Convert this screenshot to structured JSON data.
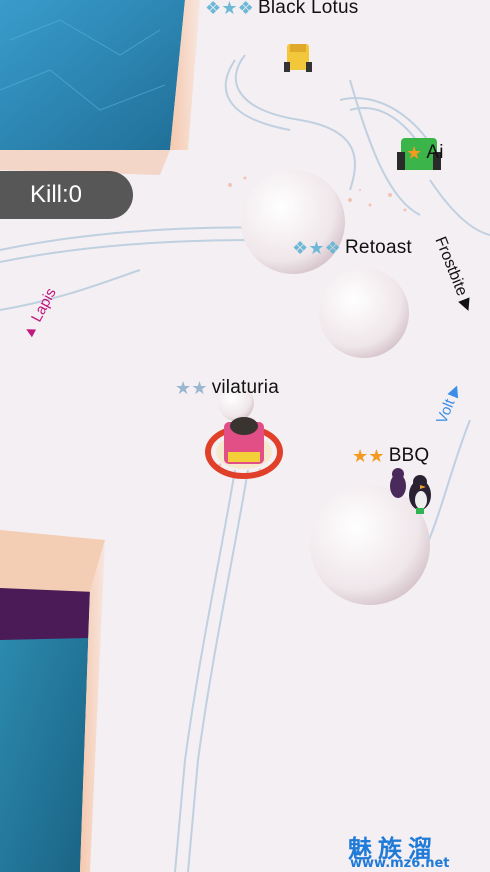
{
  "hud": {
    "kill_label": "Kill:0"
  },
  "players": {
    "black_lotus": {
      "name": "Black Lotus",
      "rank_icon": "winged-star-icon"
    },
    "ai": {
      "name": "Ai",
      "rank_icon": "orange-star-icon"
    },
    "retoast": {
      "name": "Retoast",
      "rank_icon": "winged-star-icon"
    },
    "vilaturia": {
      "name": "vilaturia",
      "rank_icon": "two-stars-icon"
    },
    "bbq": {
      "name": "BBQ",
      "rank_icon": "two-orange-stars-icon"
    }
  },
  "offscreen": {
    "lapis": {
      "name": "Lapis",
      "color": "#c2177f"
    },
    "frostbite": {
      "name": "Frostbite",
      "color": "#111111"
    },
    "volt": {
      "name": "Volt",
      "color": "#3c8ee6"
    }
  },
  "watermark": {
    "brand": "魅族溜",
    "url": "www.mz6.net"
  },
  "colors": {
    "water": "#2f8fb5",
    "ice": "#f4eff3",
    "player_ring": "#e0402a"
  }
}
